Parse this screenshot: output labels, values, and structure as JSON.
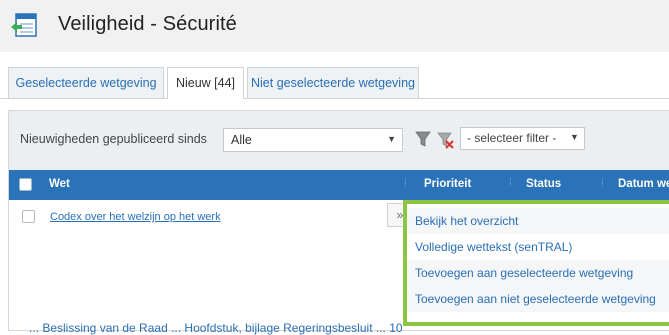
{
  "header": {
    "title": "Veiligheid - Sécurité",
    "icon": "list-back-icon"
  },
  "tabs": [
    {
      "label": "Geselecteerde wetgeving",
      "active": false
    },
    {
      "label": "Nieuw [44]",
      "active": true
    },
    {
      "label": "Niet geselecteerde wetgeving",
      "active": false
    }
  ],
  "filter": {
    "label": "Nieuwigheden gepubliceerd sinds",
    "period_value": "Alle",
    "filter_placeholder": "- selecteer filter -"
  },
  "table": {
    "columns": [
      "Wet",
      "Prioriteit",
      "Status",
      "Datum wet"
    ],
    "rows": [
      {
        "title": "Codex over het welzijn op het werk",
        "expand_label": "»"
      }
    ],
    "partial_row_text": "... Beslissing van de Raad ... Hoofdstuk, bijlage Regeringsbesluit ... 10"
  },
  "context_menu": {
    "items": [
      "Bekijk het overzicht",
      "Volledige wettekst (senTRAL)",
      "Toevoegen aan geselecteerde wetgeving",
      "Toevoegen aan niet geselecteerde wetgeving"
    ]
  },
  "colors": {
    "accent_blue": "#2a73b8",
    "link_blue": "#2a6fb6",
    "menu_border_green": "#8cc63f",
    "header_bg": "#f1f1f1"
  }
}
